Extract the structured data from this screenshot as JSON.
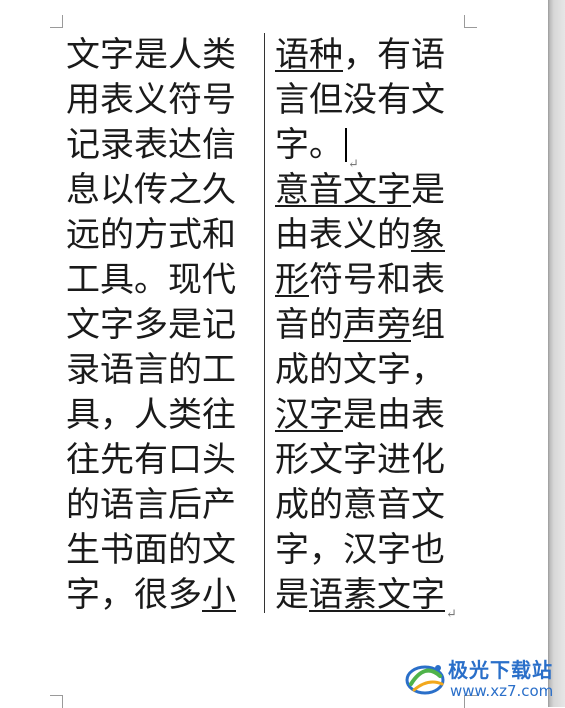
{
  "document": {
    "left_column": [
      [
        {
          "text": "文字是人类",
          "u": false
        }
      ],
      [
        {
          "text": "用表义符号",
          "u": false
        }
      ],
      [
        {
          "text": "记录表达信",
          "u": false
        }
      ],
      [
        {
          "text": "息以传之久",
          "u": false
        }
      ],
      [
        {
          "text": "远的方式和",
          "u": false
        }
      ],
      [
        {
          "text": "工具。现代",
          "u": false
        }
      ],
      [
        {
          "text": "文字多是记",
          "u": false
        }
      ],
      [
        {
          "text": "录语言的工",
          "u": false
        }
      ],
      [
        {
          "text": "具，人类往",
          "u": false
        }
      ],
      [
        {
          "text": "往先有口头",
          "u": false
        }
      ],
      [
        {
          "text": "的语言后产",
          "u": false
        }
      ],
      [
        {
          "text": "生书面的文",
          "u": false
        }
      ],
      [
        {
          "text": "字，很多",
          "u": false
        },
        {
          "text": "小",
          "u": true
        }
      ]
    ],
    "right_column": [
      [
        {
          "text": "语种",
          "u": true
        },
        {
          "text": "，有语",
          "u": false
        }
      ],
      [
        {
          "text": "言但没有文",
          "u": false
        }
      ],
      [
        {
          "text": "字。",
          "u": false
        }
      ],
      [
        {
          "text": "意音文字",
          "u": true
        },
        {
          "text": "是",
          "u": false
        }
      ],
      [
        {
          "text": "由表义的",
          "u": false
        },
        {
          "text": "象",
          "u": true
        }
      ],
      [
        {
          "text": "形",
          "u": true
        },
        {
          "text": "符号和表",
          "u": false
        }
      ],
      [
        {
          "text": "音的",
          "u": false
        },
        {
          "text": "声旁",
          "u": true
        },
        {
          "text": "组",
          "u": false
        }
      ],
      [
        {
          "text": "成的文字，",
          "u": false
        }
      ],
      [
        {
          "text": "汉字",
          "u": true
        },
        {
          "text": "是由表",
          "u": false
        }
      ],
      [
        {
          "text": "形文字进化",
          "u": false
        }
      ],
      [
        {
          "text": "成的意音文",
          "u": false
        }
      ],
      [
        {
          "text": "字，汉字也",
          "u": false
        }
      ],
      [
        {
          "text": "是",
          "u": false
        },
        {
          "text": "语素文字",
          "u": true
        }
      ]
    ],
    "paragraph_mark": "↵"
  },
  "watermark": {
    "title": "极光下载站",
    "url": "www.xz7.com"
  },
  "colors": {
    "text": "#1a1a1a",
    "watermark": "#2a6fc9"
  }
}
